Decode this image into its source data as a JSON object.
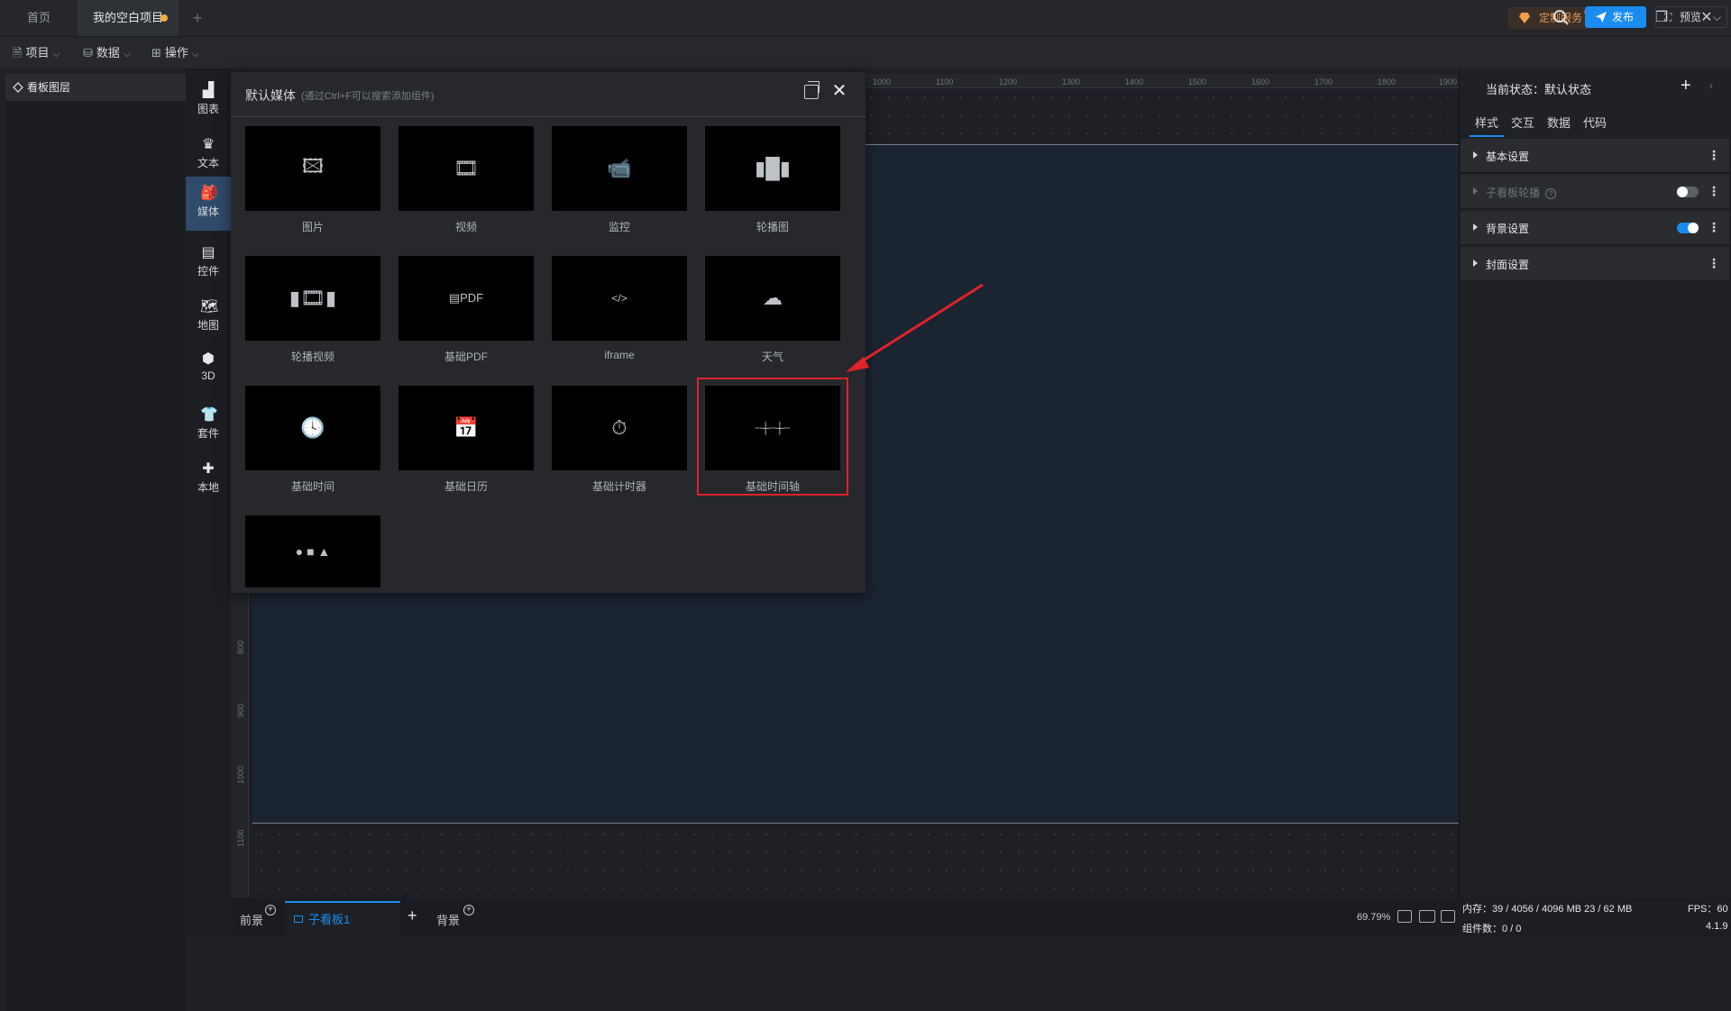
{
  "titlebar": {
    "tabs": [
      {
        "label": "首页"
      },
      {
        "label": "我的空白项目"
      }
    ],
    "custom_service": "定制服务"
  },
  "menubar": {
    "items": [
      {
        "label": "项目"
      },
      {
        "label": "数据"
      },
      {
        "label": "操作"
      }
    ],
    "publish": "发布",
    "preview": "预览"
  },
  "layers": {
    "title": "看板图层"
  },
  "categories": [
    {
      "label": "图表",
      "icon": "bar-chart-icon"
    },
    {
      "label": "文本",
      "icon": "text-icon"
    },
    {
      "label": "媒体",
      "icon": "media-icon",
      "active": true
    },
    {
      "label": "控件",
      "icon": "control-icon"
    },
    {
      "label": "地图",
      "icon": "map-icon"
    },
    {
      "label": "3D",
      "icon": "cube-icon"
    },
    {
      "label": "套件",
      "icon": "shirt-icon"
    },
    {
      "label": "本地",
      "icon": "puzzle-icon"
    }
  ],
  "ruler": {
    "top": [
      "1000",
      "1100",
      "1200",
      "1300",
      "1400",
      "1500",
      "1600",
      "1700",
      "1800",
      "1900"
    ],
    "left": [
      "800",
      "900",
      "1000",
      "1100"
    ]
  },
  "media_popup": {
    "title": "默认媒体",
    "hint": "(通过Ctrl+F可以搜索添加组件)",
    "items": [
      {
        "label": "图片",
        "icon": "image-icon"
      },
      {
        "label": "视频",
        "icon": "video-icon"
      },
      {
        "label": "监控",
        "icon": "camera-icon"
      },
      {
        "label": "轮播图",
        "icon": "carousel-icon"
      },
      {
        "label": "轮播视频",
        "icon": "carousel-video-icon"
      },
      {
        "label": "基础PDF",
        "icon": "pdf-icon"
      },
      {
        "label": "iframe",
        "icon": "iframe-icon"
      },
      {
        "label": "天气",
        "icon": "cloud-icon"
      },
      {
        "label": "基础时间",
        "icon": "clock-icon"
      },
      {
        "label": "基础日历",
        "icon": "calendar-icon"
      },
      {
        "label": "基础计时器",
        "icon": "stopwatch-icon"
      },
      {
        "label": "基础时间轴",
        "icon": "timeline-icon"
      },
      {
        "label": "",
        "icon": "shapes-icon"
      }
    ]
  },
  "props": {
    "state": "当前状态：默认状态",
    "tabs": [
      "样式",
      "交互",
      "数据",
      "代码"
    ],
    "sections": [
      {
        "label": "基本设置"
      },
      {
        "label": "子看板轮播"
      },
      {
        "label": "背景设置"
      },
      {
        "label": "封面设置"
      }
    ]
  },
  "bottom": {
    "foreground": "前景",
    "sub_board": "子看板1",
    "background": "背景",
    "zoom": "69.79%"
  },
  "status": {
    "memory": "内存：39 / 4056 / 4096 MB  23 / 62 MB",
    "fps": "FPS：60",
    "components": "组件数：0 / 0",
    "version": "4.1.9"
  },
  "colors": {
    "accent": "#1a8cf0",
    "highlight": "#e0222a",
    "unsaved_dot": "#f5b03a"
  }
}
